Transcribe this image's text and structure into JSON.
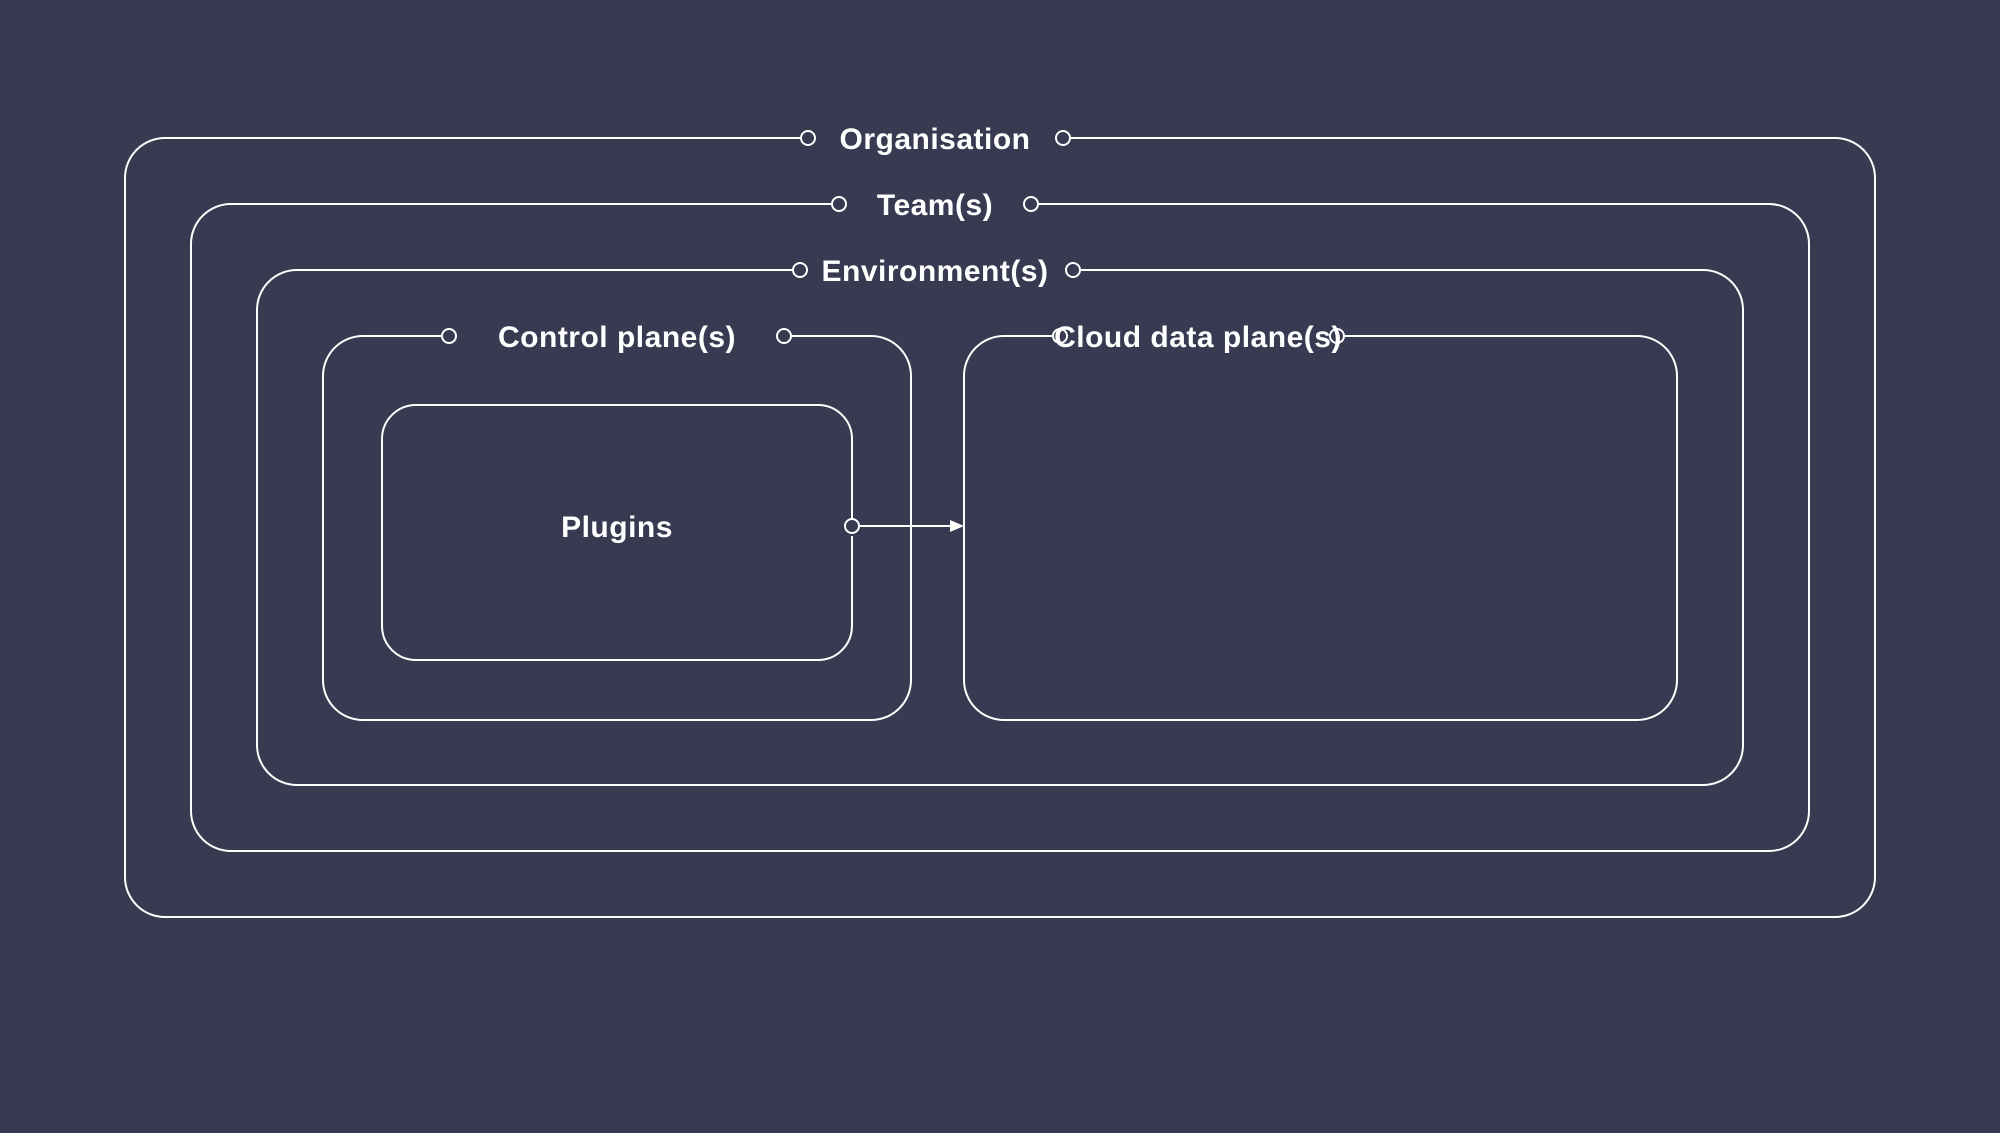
{
  "colors": {
    "background": "#383a52",
    "stroke": "#ffffff",
    "text": "#ffffff"
  },
  "diagram": {
    "organisation": {
      "label": "Organisation"
    },
    "teams": {
      "label": "Team(s)"
    },
    "environments": {
      "label": "Environment(s)"
    },
    "control_plane": {
      "label": "Control plane(s)"
    },
    "data_plane": {
      "label": "Cloud data plane(s)"
    },
    "plugins": {
      "label": "Plugins"
    }
  }
}
